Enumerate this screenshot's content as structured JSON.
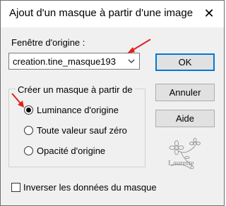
{
  "window": {
    "title": "Ajout d'un masque à partir d'une image",
    "close_glyph": "✕"
  },
  "source": {
    "label": "Fenêtre d'origine :",
    "selected": "creation.tine_masque193"
  },
  "buttons": {
    "ok": "OK",
    "cancel": "Annuler",
    "help": "Aide"
  },
  "mask_group": {
    "label": "Créer un masque à partir de",
    "options": [
      {
        "label": "Luminance d'origine",
        "checked": true
      },
      {
        "label": "Toute valeur sauf zéro",
        "checked": false
      },
      {
        "label": "Opacité d'origine",
        "checked": false
      }
    ]
  },
  "invert": {
    "label": "Inverser les données du masque",
    "checked": false
  },
  "watermark": {
    "text": "Laurette"
  },
  "colors": {
    "arrow": "#e02020",
    "default_border": "#0078d7",
    "dialog_bg": "#f0f0f0"
  }
}
